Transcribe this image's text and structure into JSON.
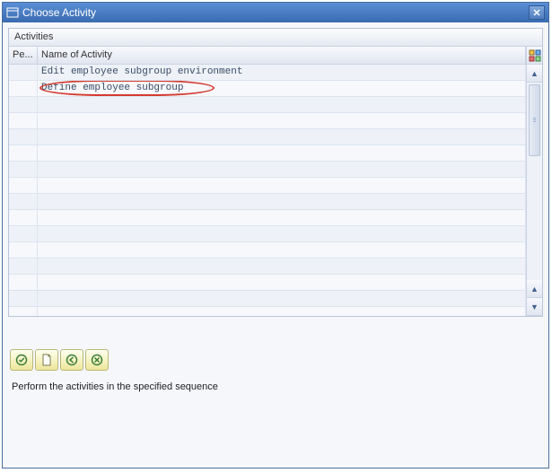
{
  "dialog": {
    "title": "Choose Activity"
  },
  "panel": {
    "header": "Activities"
  },
  "table": {
    "columns": {
      "pe": "Pe...",
      "name": "Name of Activity"
    },
    "rows": [
      {
        "pe": "",
        "name": "Edit employee subgroup environment",
        "highlight": false
      },
      {
        "pe": "",
        "name": "Define employee subgroup",
        "highlight": true
      }
    ],
    "empty_row_count": 14
  },
  "icons": {
    "config": "table-config-icon",
    "scroll_up": "▲",
    "scroll_down": "▼"
  },
  "toolbar": {
    "buttons": [
      {
        "name": "choose-button"
      },
      {
        "name": "document-button"
      },
      {
        "name": "back-button"
      },
      {
        "name": "cancel-button"
      }
    ]
  },
  "instruction": "Perform the activities in the specified sequence"
}
